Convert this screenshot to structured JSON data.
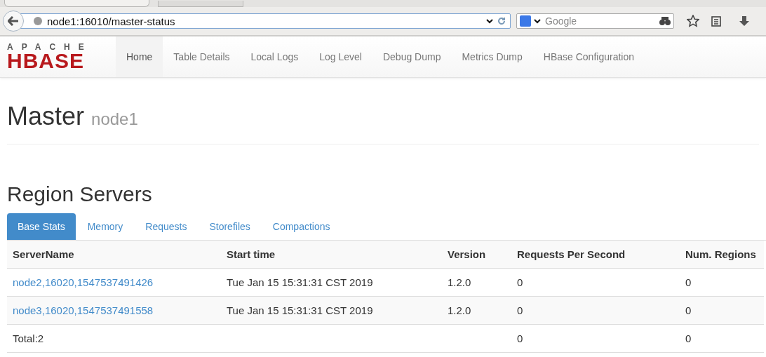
{
  "browser": {
    "url": "node1:16010/master-status",
    "search_placeholder": "Google"
  },
  "logo": {
    "top": "APACHE",
    "main": "HBASE"
  },
  "nav": [
    {
      "label": "Home",
      "selected": true
    },
    {
      "label": "Table Details",
      "selected": false
    },
    {
      "label": "Local Logs",
      "selected": false
    },
    {
      "label": "Log Level",
      "selected": false
    },
    {
      "label": "Debug Dump",
      "selected": false
    },
    {
      "label": "Metrics Dump",
      "selected": false
    },
    {
      "label": "HBase Configuration",
      "selected": false
    }
  ],
  "page_title": {
    "title": "Master",
    "subtitle": "node1"
  },
  "section_title": "Region Servers",
  "tabs": [
    {
      "label": "Base Stats",
      "selected": true
    },
    {
      "label": "Memory",
      "selected": false
    },
    {
      "label": "Requests",
      "selected": false
    },
    {
      "label": "Storefiles",
      "selected": false
    },
    {
      "label": "Compactions",
      "selected": false
    }
  ],
  "table": {
    "columns": [
      "ServerName",
      "Start time",
      "Version",
      "Requests Per Second",
      "Num. Regions"
    ],
    "rows": [
      {
        "server": "node2,16020,1547537491426",
        "start": "Tue Jan 15 15:31:31 CST 2019",
        "version": "1.2.0",
        "rps": "0",
        "regions": "0"
      },
      {
        "server": "node3,16020,1547537491558",
        "start": "Tue Jan 15 15:31:31 CST 2019",
        "version": "1.2.0",
        "rps": "0",
        "regions": "0"
      }
    ],
    "total": {
      "label": "Total:2",
      "rps": "0",
      "regions": "0"
    }
  }
}
